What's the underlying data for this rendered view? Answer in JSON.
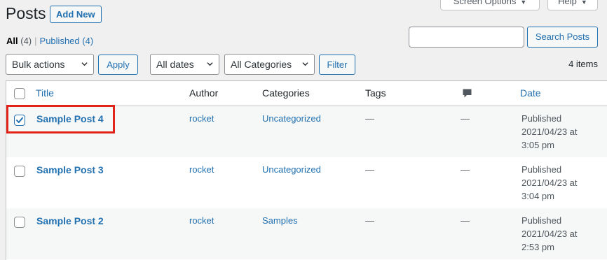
{
  "header": {
    "title": "Posts",
    "add_new_label": "Add New",
    "screen_options_label": "Screen Options",
    "help_label": "Help"
  },
  "filters": {
    "all_label": "All",
    "all_count": "(4)",
    "separator": "|",
    "published_label": "Published",
    "published_count": "(4)"
  },
  "search": {
    "value": "",
    "button_label": "Search Posts"
  },
  "tablenav": {
    "bulk_actions": "Bulk actions",
    "apply_label": "Apply",
    "dates": "All dates",
    "categories": "All Categories",
    "filter_label": "Filter",
    "item_count": "4 items"
  },
  "table": {
    "columns": {
      "title": "Title",
      "author": "Author",
      "categories": "Categories",
      "tags": "Tags",
      "comments_icon": "comment-bubble-icon",
      "date": "Date"
    },
    "rows": [
      {
        "title": "Sample Post 4",
        "author": "rocket",
        "categories": "Uncategorized",
        "tags": "—",
        "comments": "—",
        "status": "Published",
        "date": "2021/04/23 at",
        "time": "3:05 pm",
        "checked": true
      },
      {
        "title": "Sample Post 3",
        "author": "rocket",
        "categories": "Uncategorized",
        "tags": "—",
        "comments": "—",
        "status": "Published",
        "date": "2021/04/23 at",
        "time": "3:04 pm",
        "checked": false
      },
      {
        "title": "Sample Post 2",
        "author": "rocket",
        "categories": "Samples",
        "tags": "—",
        "comments": "—",
        "status": "Published",
        "date": "2021/04/23 at",
        "time": "2:53 pm",
        "checked": false
      }
    ]
  },
  "colors": {
    "link": "#2271b1",
    "highlight": "#e2231a",
    "background": "#f0f0f1"
  }
}
